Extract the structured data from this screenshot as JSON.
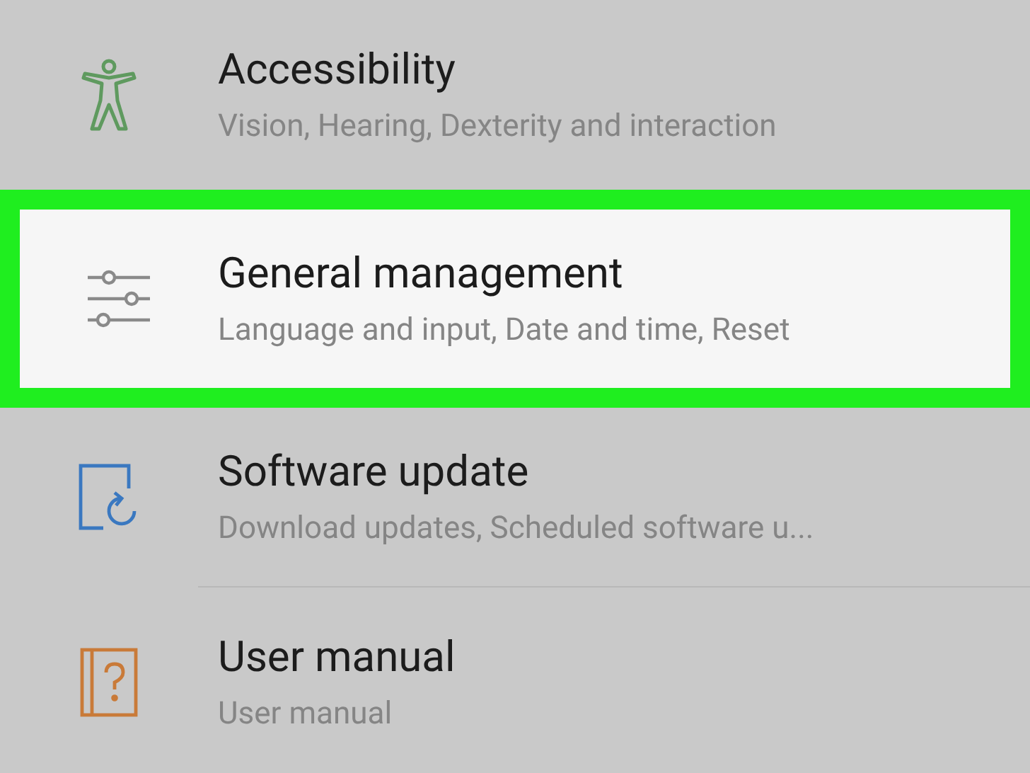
{
  "settings_items": [
    {
      "kind": "accessibility",
      "title": "Accessibility",
      "subtitle": "Vision, Hearing, Dexterity and interaction",
      "selected": false
    },
    {
      "kind": "sliders",
      "title": "General management",
      "subtitle": "Language and input, Date and time, Reset",
      "selected": true
    },
    {
      "kind": "update",
      "title": "Software update",
      "subtitle": "Download updates, Scheduled software u...",
      "selected": false
    },
    {
      "kind": "manual",
      "title": "User manual",
      "subtitle": "User manual",
      "selected": false
    }
  ]
}
